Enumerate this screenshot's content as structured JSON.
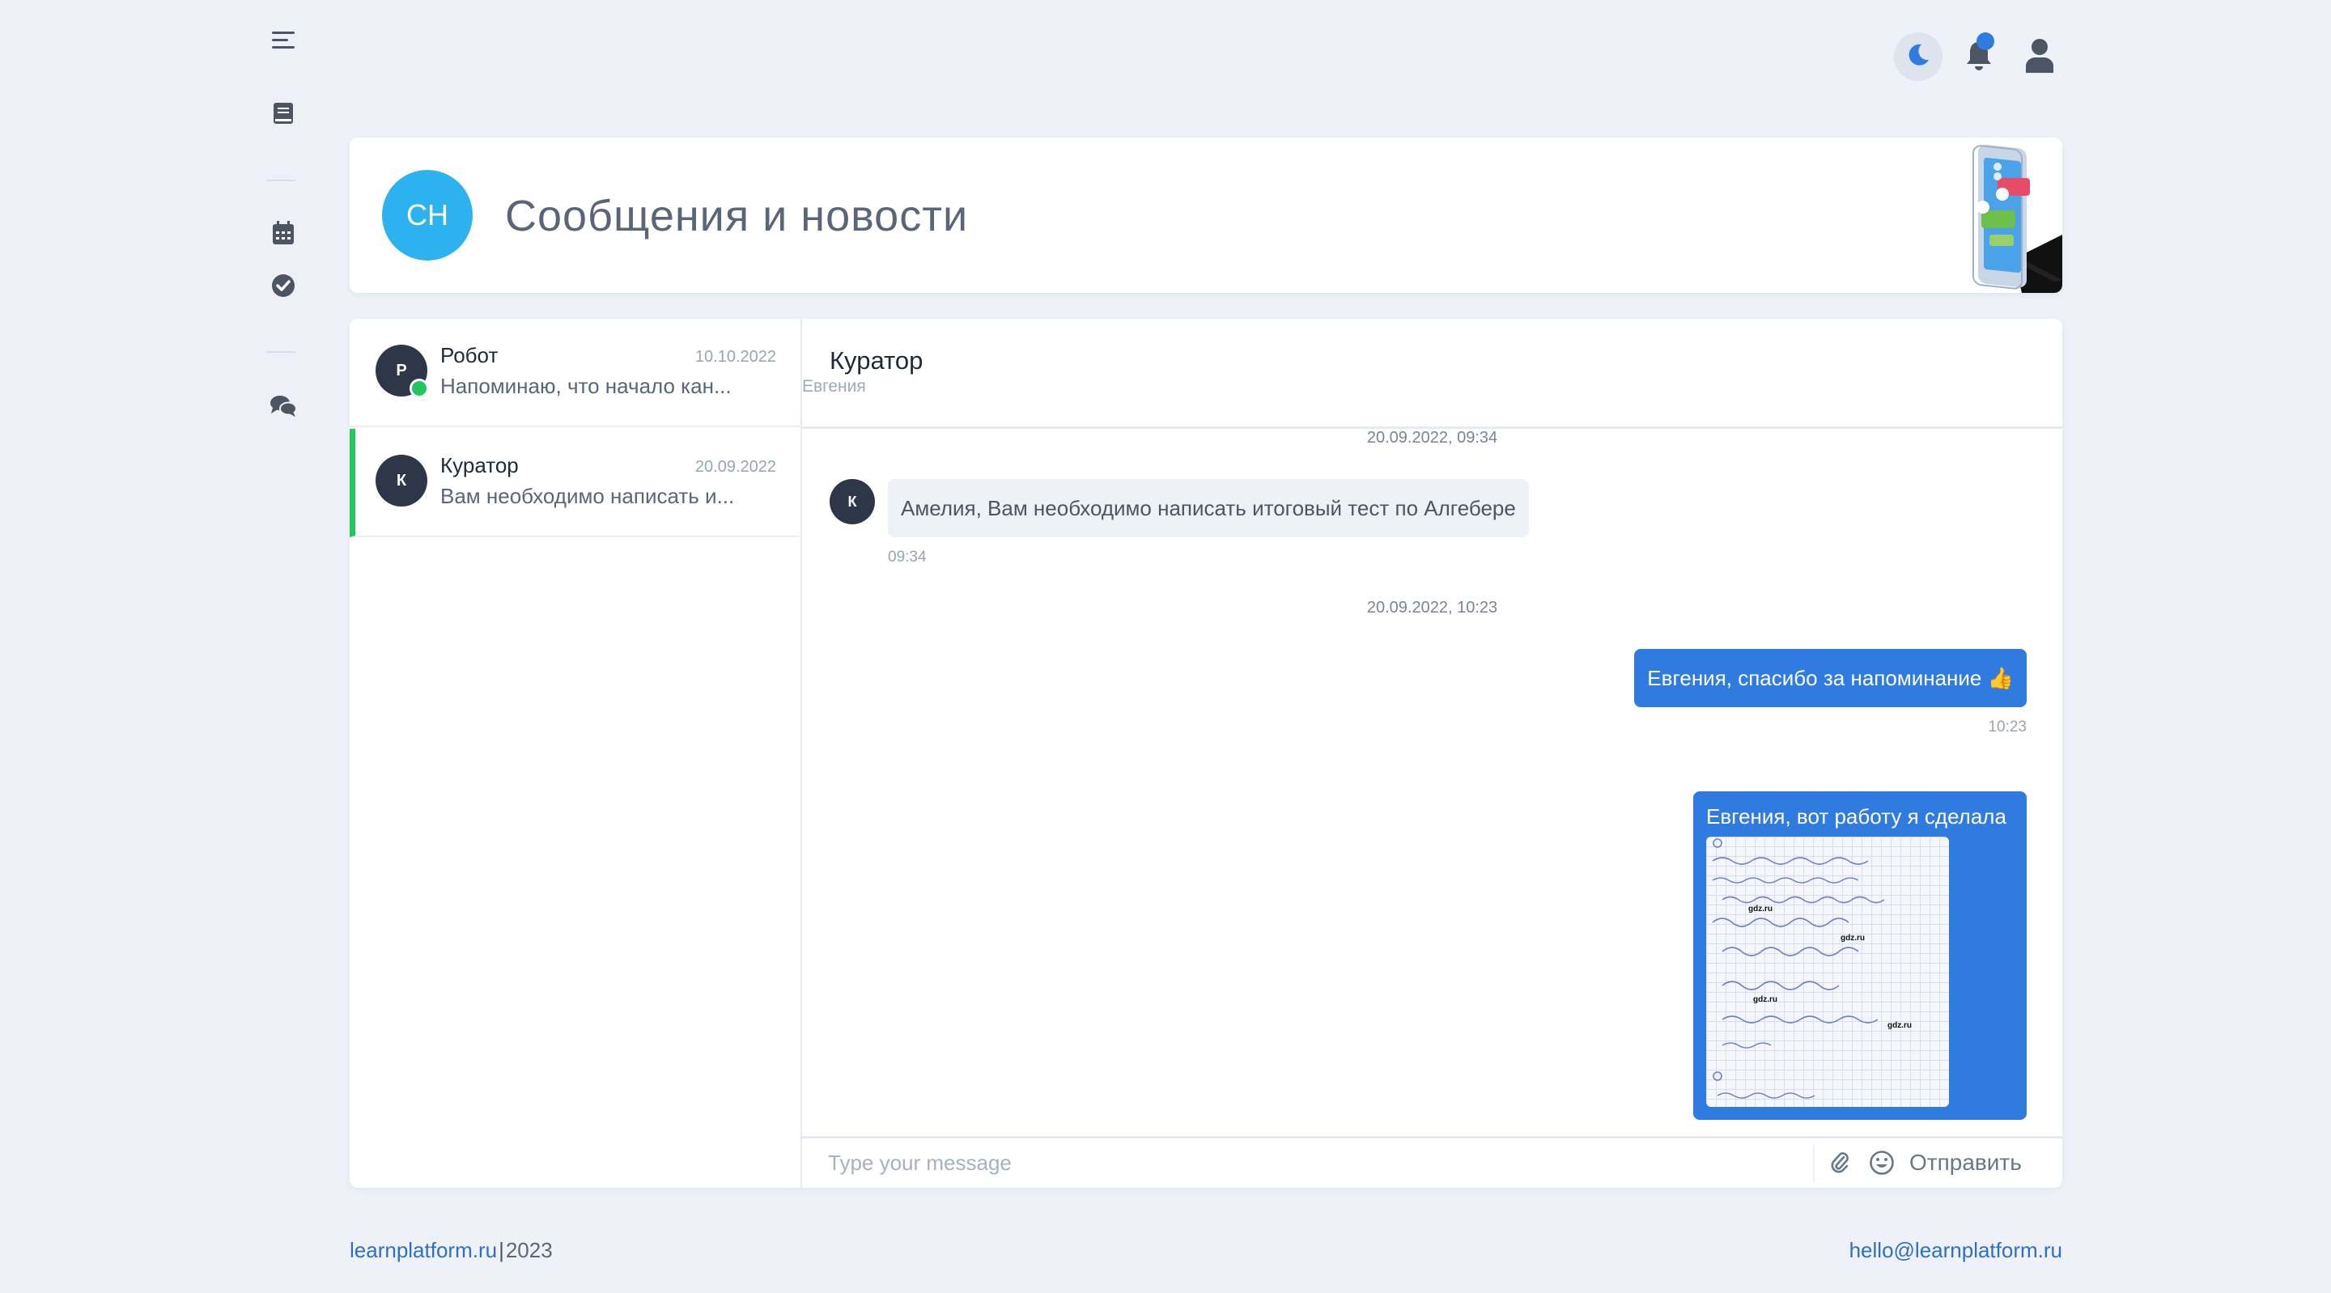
{
  "colors": {
    "accent": "#2f7be0",
    "online": "#22c55e",
    "avatar_blue": "#2cb3ef",
    "avatar_dark": "#2d3748"
  },
  "sidebar": {
    "icons": [
      "menu-icon",
      "book-icon",
      "calendar-icon",
      "check-circle-icon",
      "chat-icon"
    ]
  },
  "topbar": {
    "icons": [
      "moon-icon",
      "bell-icon",
      "user-icon"
    ]
  },
  "header": {
    "avatar_initials": "СН",
    "title": "Сообщения и новости"
  },
  "contacts": [
    {
      "initial": "Р",
      "name": "Робот",
      "date": "10.10.2022",
      "preview": "Напоминаю, что начало кан...",
      "online": true,
      "active": false
    },
    {
      "initial": "К",
      "name": "Куратор",
      "date": "20.09.2022",
      "preview": "Вам необходимо написать и...",
      "online": false,
      "active": true
    }
  ],
  "conversation": {
    "name": "Куратор",
    "subtitle": "Евгения",
    "messages": [
      {
        "date_sep": "20.09.2022, 09:34",
        "avatar": "К",
        "text": "Амелия, Вам необходимо написать итоговый тест по Алгебере",
        "time": "09:34",
        "direction": "in"
      },
      {
        "date_sep": "20.09.2022, 10:23",
        "text": "Евгения, спасибо за напоминание 👍",
        "time": "10:23",
        "direction": "out"
      },
      {
        "text": "Евгения, вот работу я сделала",
        "direction": "out",
        "attachment": {
          "watermark": "gdz.ru"
        }
      }
    ]
  },
  "composer": {
    "placeholder": "Type your message",
    "send_label": "Отправить"
  },
  "footer": {
    "site": "learnplatform.ru",
    "separator": "|",
    "year": "2023",
    "email": "hello@learnplatform.ru"
  }
}
